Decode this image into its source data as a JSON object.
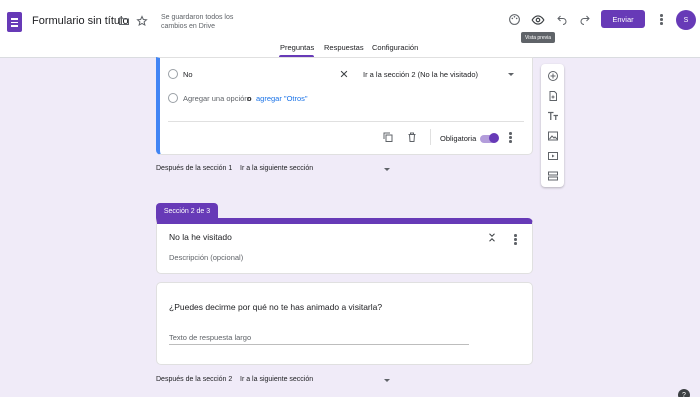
{
  "header": {
    "title": "Formulario sin título",
    "saved_status": "Se guardaron todos los cambios en Drive",
    "send_label": "Enviar",
    "avatar_initial": "S",
    "preview_tooltip": "Vista previa",
    "brand_color": "#673ab7"
  },
  "tabs": [
    {
      "label": "Preguntas",
      "active": true
    },
    {
      "label": "Respuestas",
      "active": false
    },
    {
      "label": "Configuración",
      "active": false
    }
  ],
  "question_card": {
    "option_no": "No",
    "option_no_goto": "Ir a la sección 2 (No la he visitado)",
    "add_option": "Agregar una opción",
    "or_text": "o",
    "add_other": "agregar \"Otros\"",
    "required_label": "Obligatoria",
    "required": true
  },
  "after_section_1": {
    "label": "Después de la sección 1",
    "value": "Ir a la siguiente sección"
  },
  "section2": {
    "tab_label": "Sección 2 de 3",
    "title": "No la he visitado",
    "description_placeholder": "Descripción (opcional)"
  },
  "question2": {
    "title": "¿Puedes decirme por qué no te has animado a visitarla?",
    "answer_placeholder": "Texto de respuesta largo"
  },
  "after_section_2": {
    "label": "Después de la sección 2",
    "value": "Ir a la siguiente sección"
  },
  "help_label": "?"
}
